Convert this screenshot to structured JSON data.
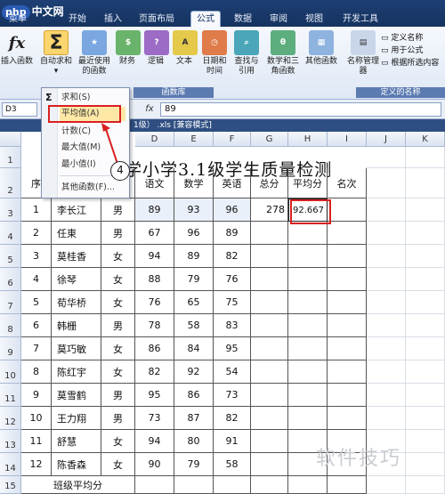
{
  "brand": {
    "tag": "php",
    "name": "中文网"
  },
  "tabs": [
    "菜单",
    "开始",
    "插入",
    "页面布局",
    "公式",
    "数据",
    "审阅",
    "视图",
    "开发工具"
  ],
  "active_tab": "公式",
  "ribbon": {
    "insert_function": "插入函数",
    "autosum": "自动求和",
    "recent": "最近使用的函数",
    "financial": "财务",
    "logical": "逻辑",
    "text": "文本",
    "datetime": "日期和时间",
    "lookup": "查找与引用",
    "math": "数学和三角函数",
    "more": "其他函数",
    "name_manager": "名称管理器",
    "define_name": "定义名称",
    "use_in_formula": "用于公式",
    "create_from_selection": "根据所选内容",
    "group_library": "函数库",
    "group_names": "定义的名称"
  },
  "menu": {
    "items": [
      "求和(S)",
      "平均值(A)",
      "计数(C)",
      "最大值(M)",
      "最小值(I)",
      "其他函数(F)..."
    ],
    "highlighted": "平均值(A)"
  },
  "formula_bar": {
    "name_box": "D3",
    "fx": "fx",
    "value": "89"
  },
  "window_title": "1级） .xls  [兼容模式]",
  "columns": [
    "D",
    "E",
    "F",
    "G",
    "H",
    "I",
    "J",
    "K"
  ],
  "rows": [
    "1",
    "2",
    "3",
    "4",
    "5",
    "6",
    "7",
    "8",
    "9",
    "10",
    "11",
    "12",
    "13",
    "14",
    "15"
  ],
  "sheet_title": "学小学3.1级学生质量检测",
  "headers": {
    "seq": "序",
    "chinese": "语文",
    "math": "数学",
    "english": "英语",
    "total": "总分",
    "avg": "平均分",
    "rank": "名次"
  },
  "students": [
    {
      "no": "1",
      "name": "李长江",
      "sex": "男",
      "chinese": "89",
      "math": "93",
      "english": "96",
      "total": "278",
      "avg": "92.667"
    },
    {
      "no": "2",
      "name": "任東",
      "sex": "男",
      "chinese": "67",
      "math": "96",
      "english": "89"
    },
    {
      "no": "3",
      "name": "莫桂香",
      "sex": "女",
      "chinese": "94",
      "math": "89",
      "english": "82"
    },
    {
      "no": "4",
      "name": "徐琴",
      "sex": "女",
      "chinese": "88",
      "math": "79",
      "english": "76"
    },
    {
      "no": "5",
      "name": "荀华桥",
      "sex": "女",
      "chinese": "76",
      "math": "65",
      "english": "75"
    },
    {
      "no": "6",
      "name": "韩栅",
      "sex": "男",
      "chinese": "78",
      "math": "58",
      "english": "83"
    },
    {
      "no": "7",
      "name": "莫巧敏",
      "sex": "女",
      "chinese": "86",
      "math": "84",
      "english": "95"
    },
    {
      "no": "8",
      "name": "陈红宇",
      "sex": "女",
      "chinese": "82",
      "math": "92",
      "english": "54"
    },
    {
      "no": "9",
      "name": "莫雪鹤",
      "sex": "男",
      "chinese": "95",
      "math": "86",
      "english": "73"
    },
    {
      "no": "10",
      "name": "王力翔",
      "sex": "男",
      "chinese": "73",
      "math": "87",
      "english": "82"
    },
    {
      "no": "11",
      "name": "舒慧",
      "sex": "女",
      "chinese": "94",
      "math": "80",
      "english": "91"
    },
    {
      "no": "12",
      "name": "陈香森",
      "sex": "女",
      "chinese": "90",
      "math": "79",
      "english": "58"
    }
  ],
  "class_avg_label": "班级平均分",
  "step_marker": "4",
  "watermark": "软件技巧"
}
